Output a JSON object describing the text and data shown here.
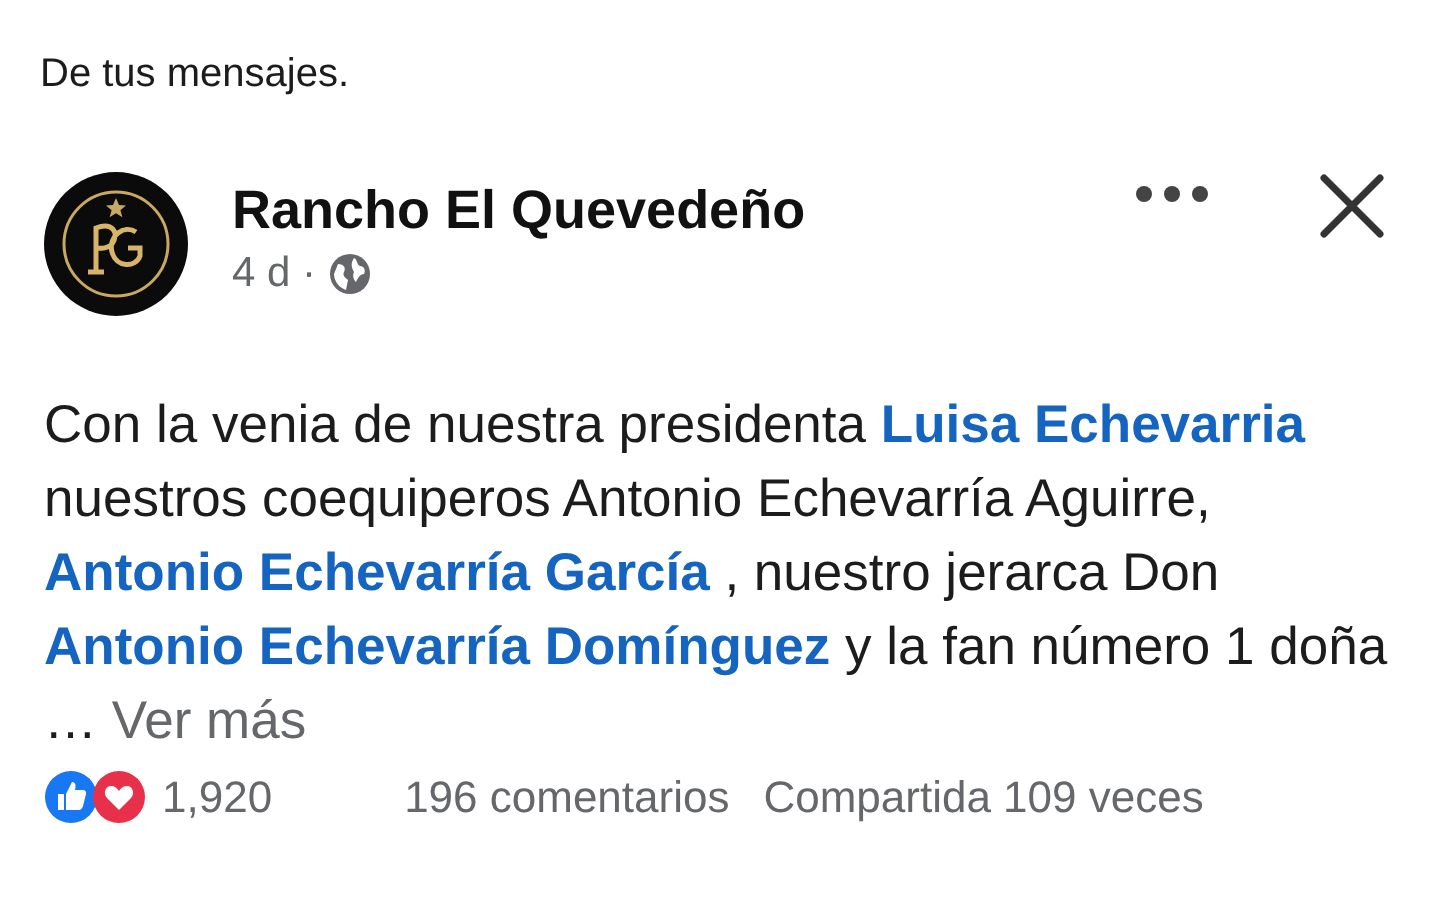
{
  "context_label": "De tus mensajes.",
  "post": {
    "author": "Rancho El Quevedeño",
    "time": "4 d ·",
    "body": [
      {
        "kind": "plain",
        "text": "Con la venia de nuestra presidenta "
      },
      {
        "kind": "mention",
        "text": "Luisa Echevarria"
      },
      {
        "kind": "plain",
        "text": " nuestros coequiperos Antonio Echevarría Aguirre, "
      },
      {
        "kind": "mention",
        "text": "Antonio Echevarría García"
      },
      {
        "kind": "plain",
        "text": " , nuestro jerarca Don "
      },
      {
        "kind": "mention",
        "text": "Antonio Echevarría Domínguez"
      },
      {
        "kind": "plain",
        "text": " y la fan número 1 doña … "
      },
      {
        "kind": "more",
        "text": "Ver más"
      }
    ],
    "reactions_count": "1,920",
    "comments": "196 comentarios",
    "shares": "Compartida 109 veces"
  }
}
